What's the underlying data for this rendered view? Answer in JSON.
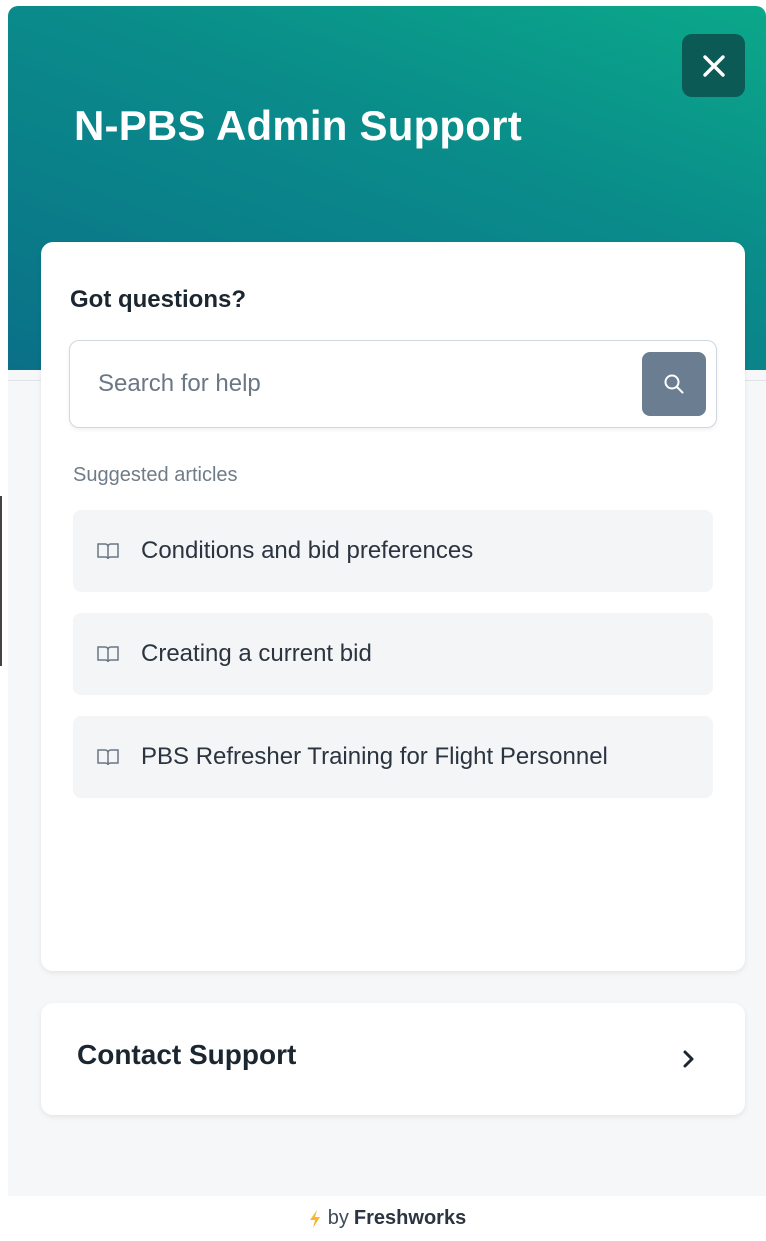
{
  "header": {
    "title": "N-PBS Admin Support",
    "close_icon": "close-icon"
  },
  "help_card": {
    "title": "Got questions?",
    "search": {
      "placeholder": "Search for help",
      "value": "",
      "icon": "search-icon"
    },
    "suggested_label": "Suggested articles",
    "articles": [
      {
        "icon": "book-icon",
        "label": "Conditions and bid preferences"
      },
      {
        "icon": "book-icon",
        "label": "Creating a current bid"
      },
      {
        "icon": "book-icon",
        "label": "PBS Refresher Training for Flight Personnel"
      }
    ]
  },
  "contact": {
    "label": "Contact Support",
    "icon": "chevron-right-icon"
  },
  "footer": {
    "by": "by",
    "brand": "Freshworks",
    "icon": "bolt-icon"
  },
  "colors": {
    "header_gradient_start": "#0ba88a",
    "header_gradient_end": "#0a7088",
    "close_button": "#0b5a55",
    "search_button": "#6b7d90",
    "bolt": "#f5b82e"
  }
}
